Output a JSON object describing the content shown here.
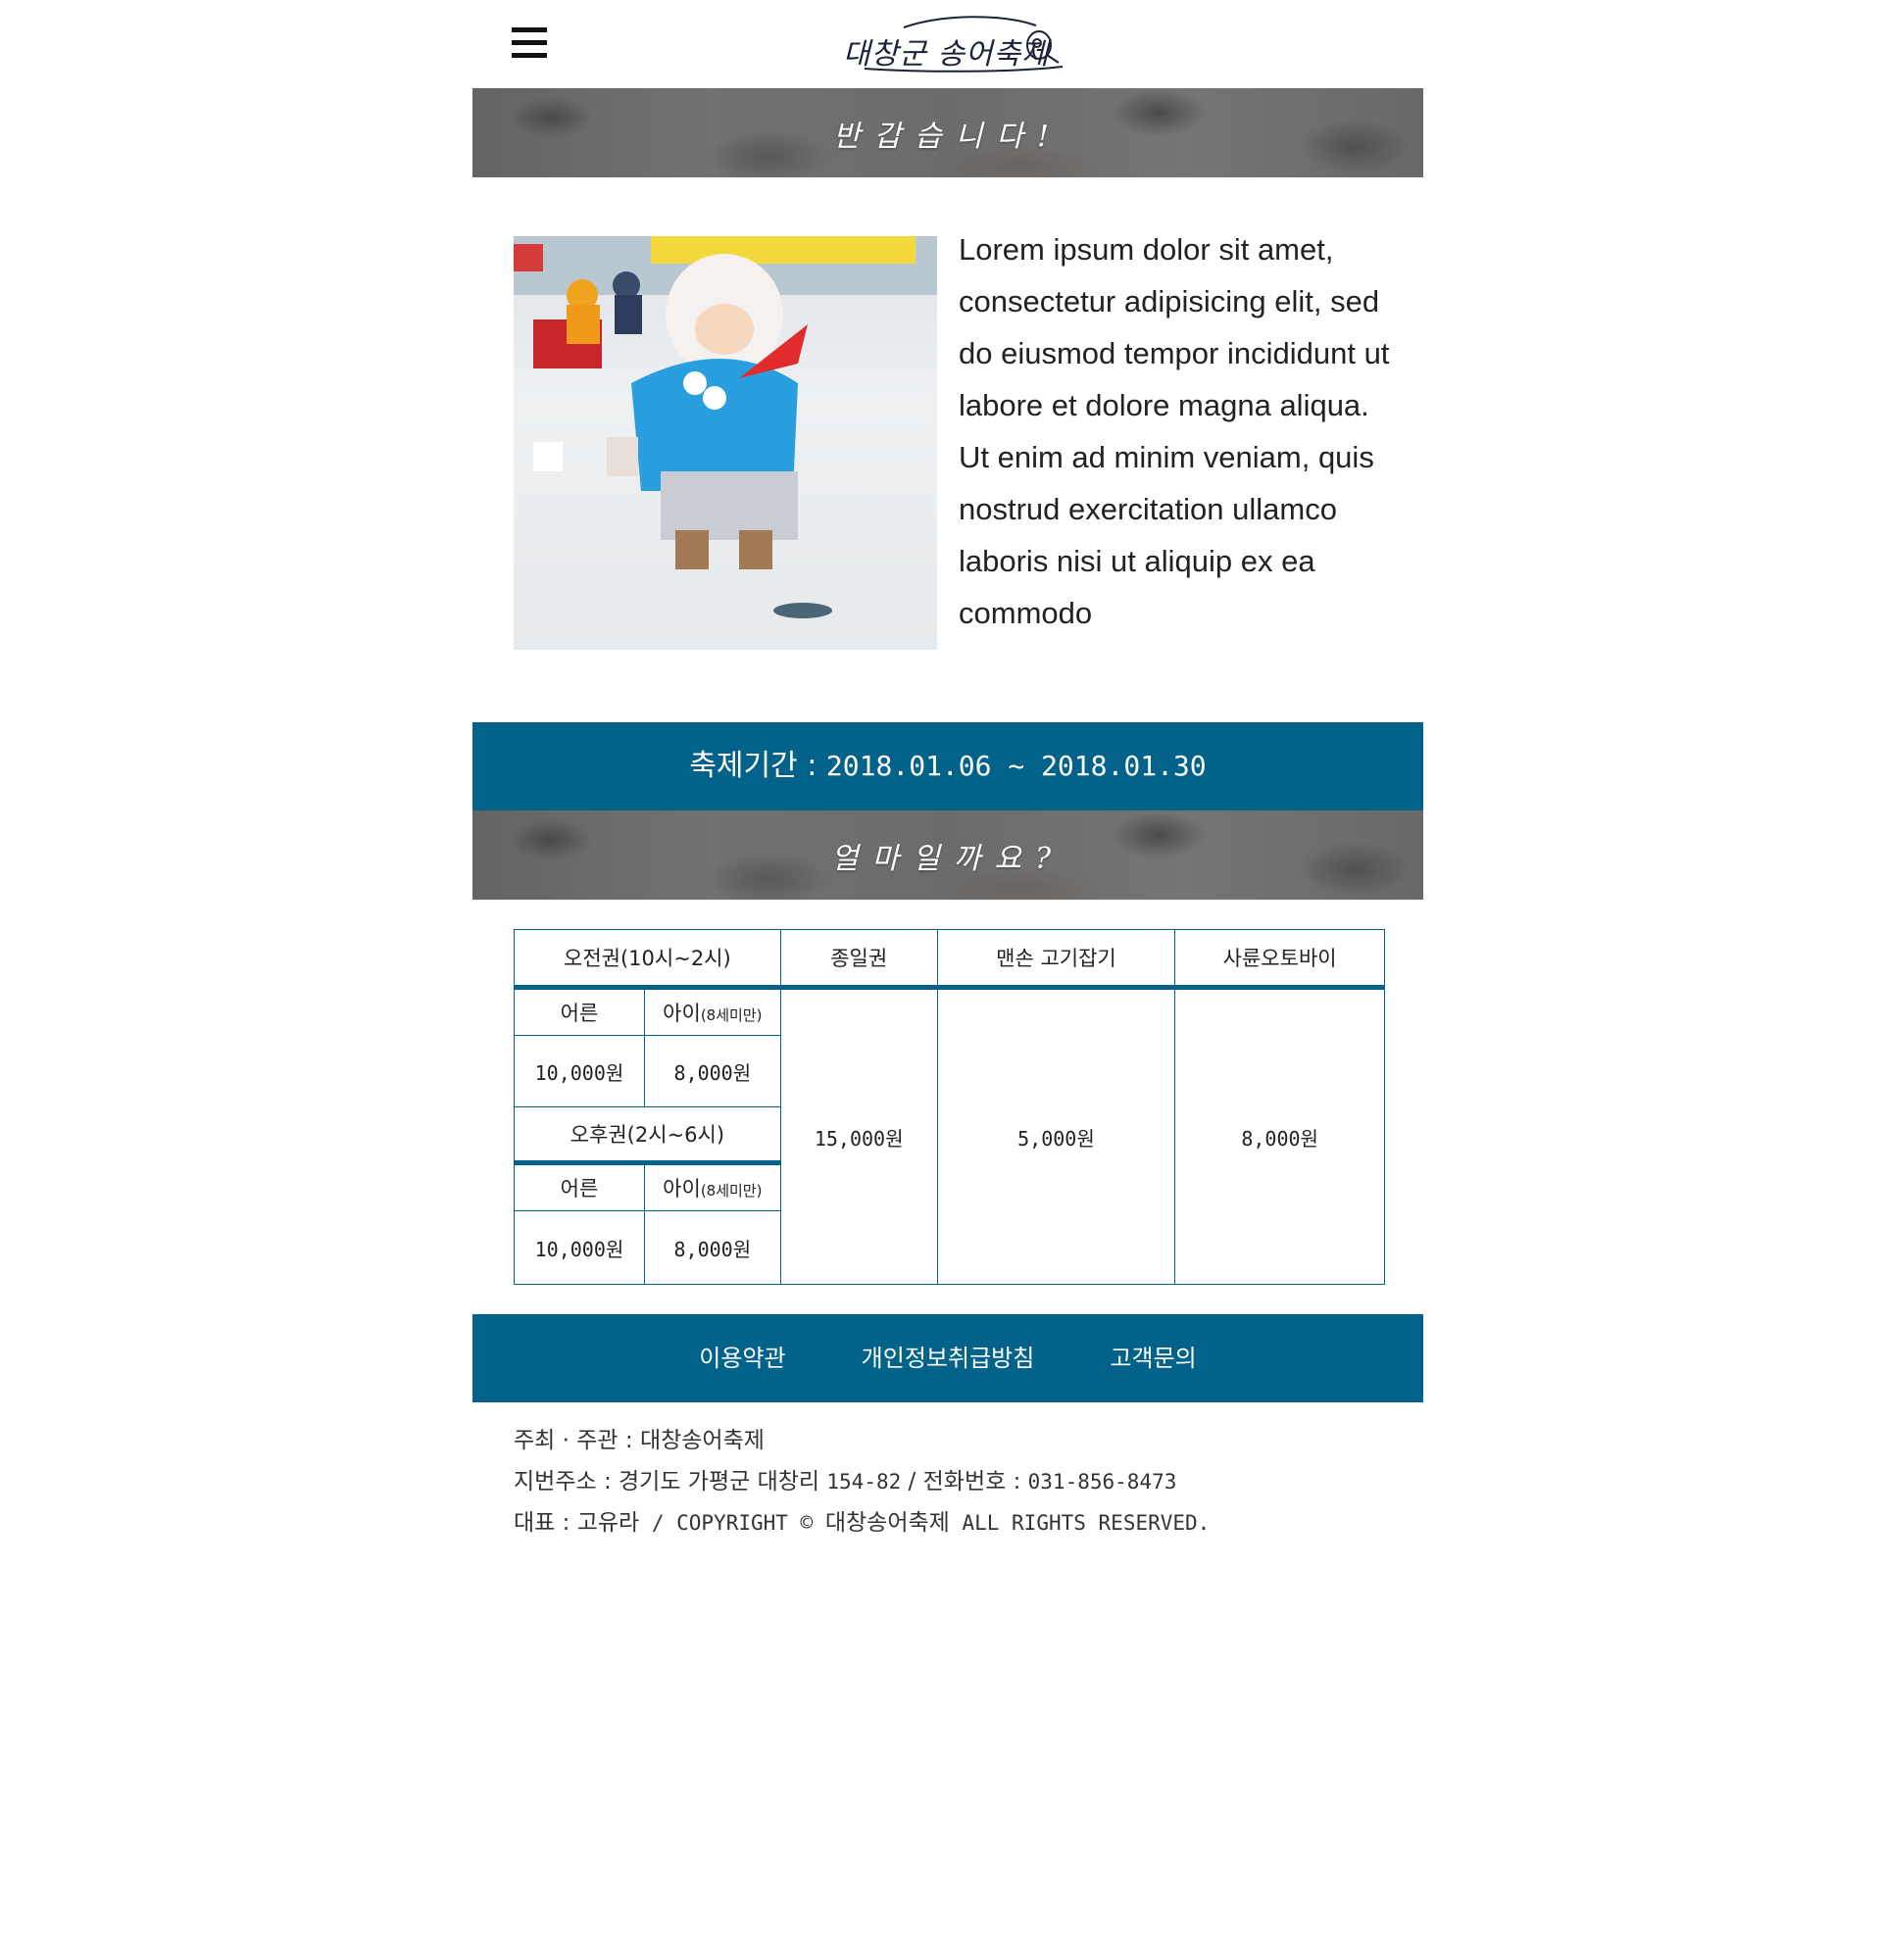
{
  "header": {
    "menu_icon": "hamburger-menu-icon",
    "logo_text": "대창군 송어축제",
    "logo_icon": "fish-icon"
  },
  "welcome_banner": {
    "title": "반갑습니다!"
  },
  "intro": {
    "photo_alt": "child-ice-fishing-photo",
    "text": "Lorem ipsum dolor sit amet, consectetur adipisicing elit, sed do eiusmod tempor incididunt ut labore et dolore magna aliqua. Ut enim ad minim veniam, quis nostrud exercitation ullamco laboris nisi ut aliquip ex ea commodo"
  },
  "period": {
    "label": "축제기간 : ",
    "dates": "2018.01.06 ~ 2018.01.30"
  },
  "price_banner": {
    "title": "얼마일까요?"
  },
  "price_table": {
    "headers": [
      "오전권(10시~2시)",
      "종일권",
      "맨손 고기잡기",
      "사륜오토바이"
    ],
    "morning": {
      "adult_label": "어른",
      "child_label": "아이",
      "child_note": "(8세미만)",
      "adult_price": "10,000원",
      "child_price": "8,000원"
    },
    "afternoon": {
      "title": "오후권(2시~6시)",
      "adult_label": "어른",
      "child_label": "아이",
      "child_note": "(8세미만)",
      "adult_price": "10,000원",
      "child_price": "8,000원"
    },
    "allday_price": "15,000원",
    "barehand_price": "5,000원",
    "atv_price": "8,000원"
  },
  "footer_nav": {
    "terms": "이용약관",
    "privacy": "개인정보취급방침",
    "contact": "고객문의"
  },
  "footer_info": {
    "host_label": "주최 · 주관 : ",
    "host": "대창송어축제",
    "address_label": "지번주소 : ",
    "address": "경기도 가평군 대창리 ",
    "address_num": "154-82",
    "phone_label": " / 전화번호 : ",
    "phone": "031-856-8473",
    "ceo_label": "대표 : ",
    "ceo": "고유라",
    "copyright_prefix": " / COPYRIGHT © ",
    "copyright_name": "대창송어축제",
    "copyright_suffix": " ALL RIGHTS RESERVED."
  },
  "colors": {
    "accent": "#02628a",
    "text": "#222222"
  }
}
